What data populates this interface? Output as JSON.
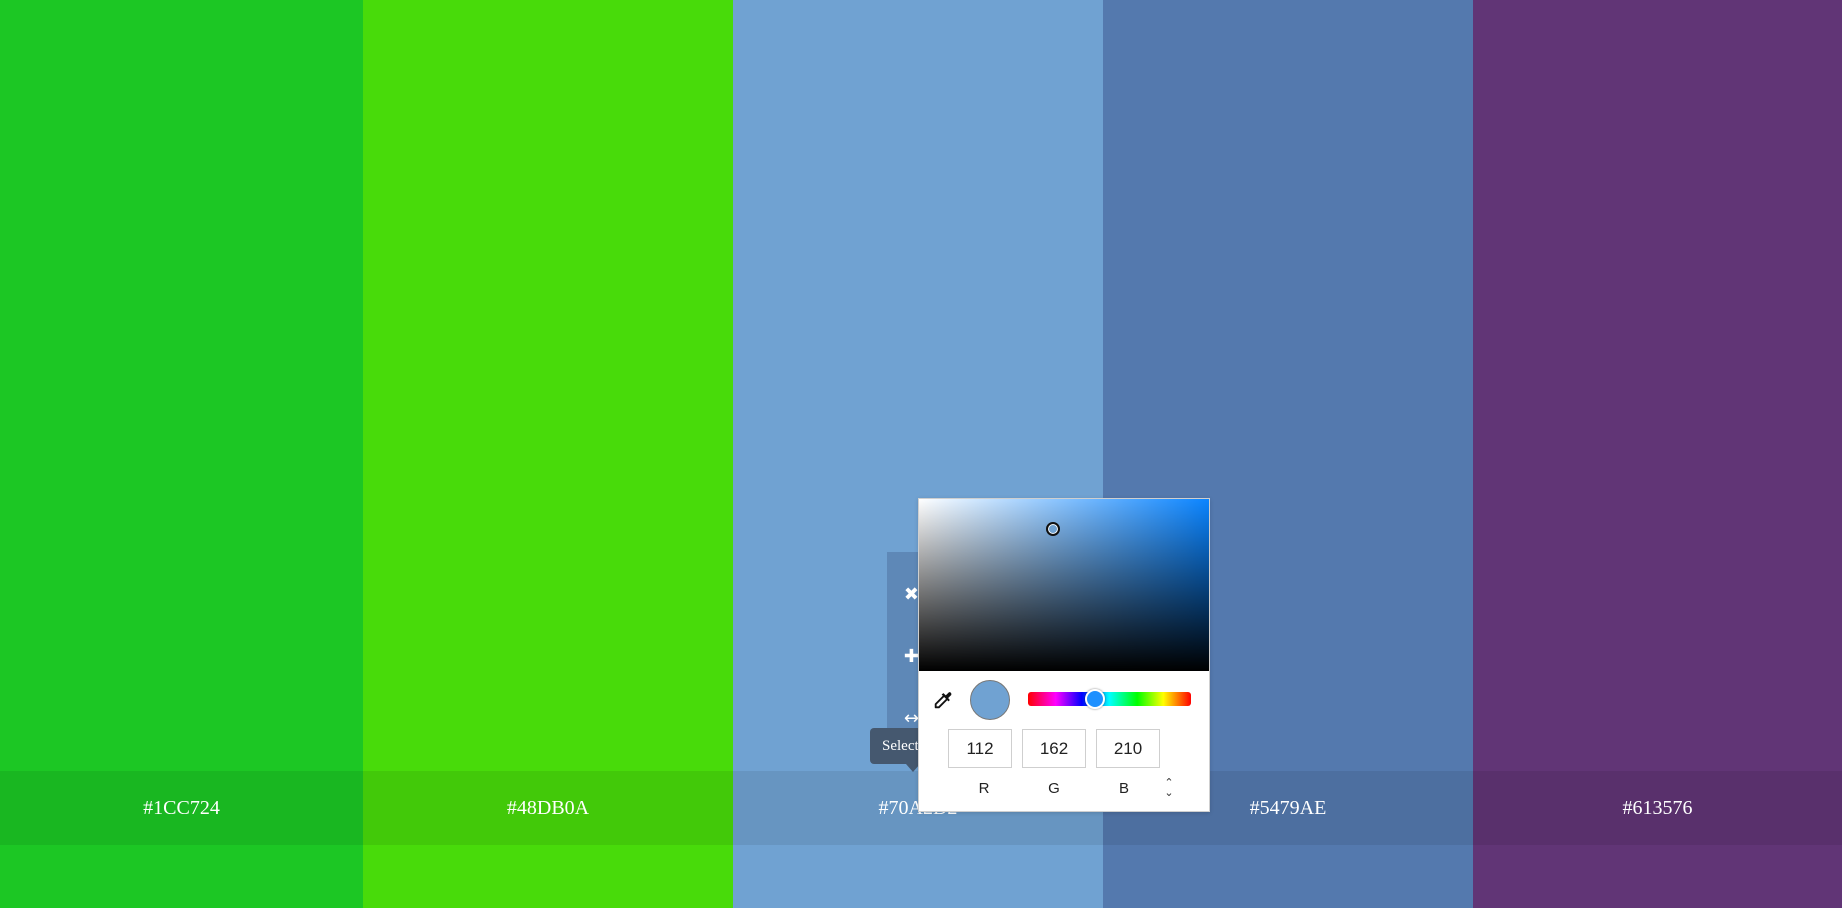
{
  "colors": [
    {
      "hex": "#1CC724",
      "label": "#1CC724"
    },
    {
      "hex": "#48DB0A",
      "label": "#48DB0A"
    },
    {
      "hex": "#70A2D2",
      "label": "#70A2D2"
    },
    {
      "hex": "#5479AE",
      "label": "#5479AE"
    },
    {
      "hex": "#613576",
      "label": "#613576"
    }
  ],
  "toolbar": {
    "icons": [
      "close-icon",
      "plus-icon",
      "arrows-icon"
    ],
    "tooltip": "Select"
  },
  "picker": {
    "sv_hue_color": "#0a84ff",
    "current_color": "#70A2D2",
    "hue_handle_color": "#1e90ff",
    "eyedropper_icon": "eyedropper-icon",
    "mode_toggle_icon": "chevron-updown-icon",
    "r": "112",
    "g": "162",
    "b": "210",
    "labels": {
      "r": "R",
      "g": "G",
      "b": "B"
    }
  }
}
